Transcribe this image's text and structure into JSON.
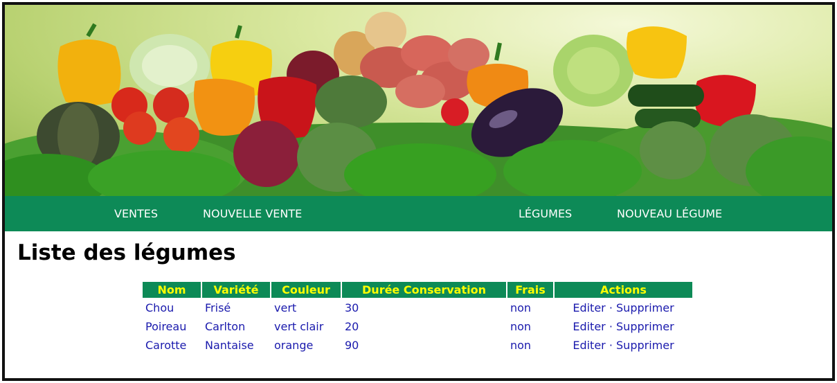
{
  "colors": {
    "nav_background": "#0d8a57",
    "nav_text": "#ffffff",
    "table_header_background": "#0d8a57",
    "table_header_text": "#ffff00",
    "cell_text": "#1a1aad",
    "frame_border": "#111111"
  },
  "banner": {
    "image_description_icon": "vegetables-banner-image"
  },
  "nav": {
    "items": [
      {
        "label": "VENTES"
      },
      {
        "label": "NOUVELLE VENTE"
      },
      {
        "label": "LÉGUMES"
      },
      {
        "label": "NOUVEAU LÉGUME"
      }
    ]
  },
  "page": {
    "title": "Liste des légumes"
  },
  "table": {
    "columns": [
      "Nom",
      "Variété",
      "Couleur",
      "Durée Conservation",
      "Frais",
      "Actions"
    ],
    "rows": [
      {
        "nom": "Chou",
        "variete": "Frisé",
        "couleur": "vert",
        "duree": "30",
        "frais": "non",
        "edit": "Editer",
        "sep": "·",
        "delete": "Supprimer"
      },
      {
        "nom": "Poireau",
        "variete": "Carlton",
        "couleur": "vert clair",
        "duree": "20",
        "frais": "non",
        "edit": "Editer",
        "sep": "·",
        "delete": "Supprimer"
      },
      {
        "nom": "Carotte",
        "variete": "Nantaise",
        "couleur": "orange",
        "duree": "90",
        "frais": "non",
        "edit": "Editer",
        "sep": "·",
        "delete": "Supprimer"
      }
    ]
  }
}
